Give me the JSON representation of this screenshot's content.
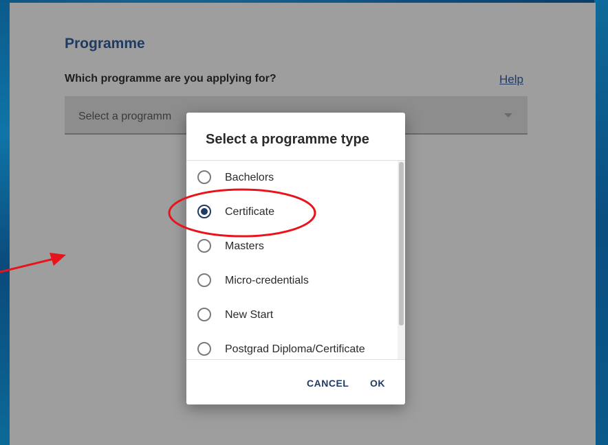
{
  "form": {
    "section_title": "Programme",
    "question": "Which programme are you applying for?",
    "help_label": "Help",
    "select_placeholder": "Select a programm"
  },
  "dialog": {
    "title": "Select a programme type",
    "options": [
      {
        "label": "Bachelors",
        "selected": false
      },
      {
        "label": "Certificate",
        "selected": true
      },
      {
        "label": "Masters",
        "selected": false
      },
      {
        "label": "Micro-credentials",
        "selected": false
      },
      {
        "label": "New Start",
        "selected": false
      },
      {
        "label": "Postgrad Diploma/Certificate",
        "selected": false
      }
    ],
    "cancel_label": "CANCEL",
    "ok_label": "OK"
  },
  "colors": {
    "brand": "#1f3a63",
    "annotation": "#e8141c",
    "overlay": "#9e9e9e"
  }
}
